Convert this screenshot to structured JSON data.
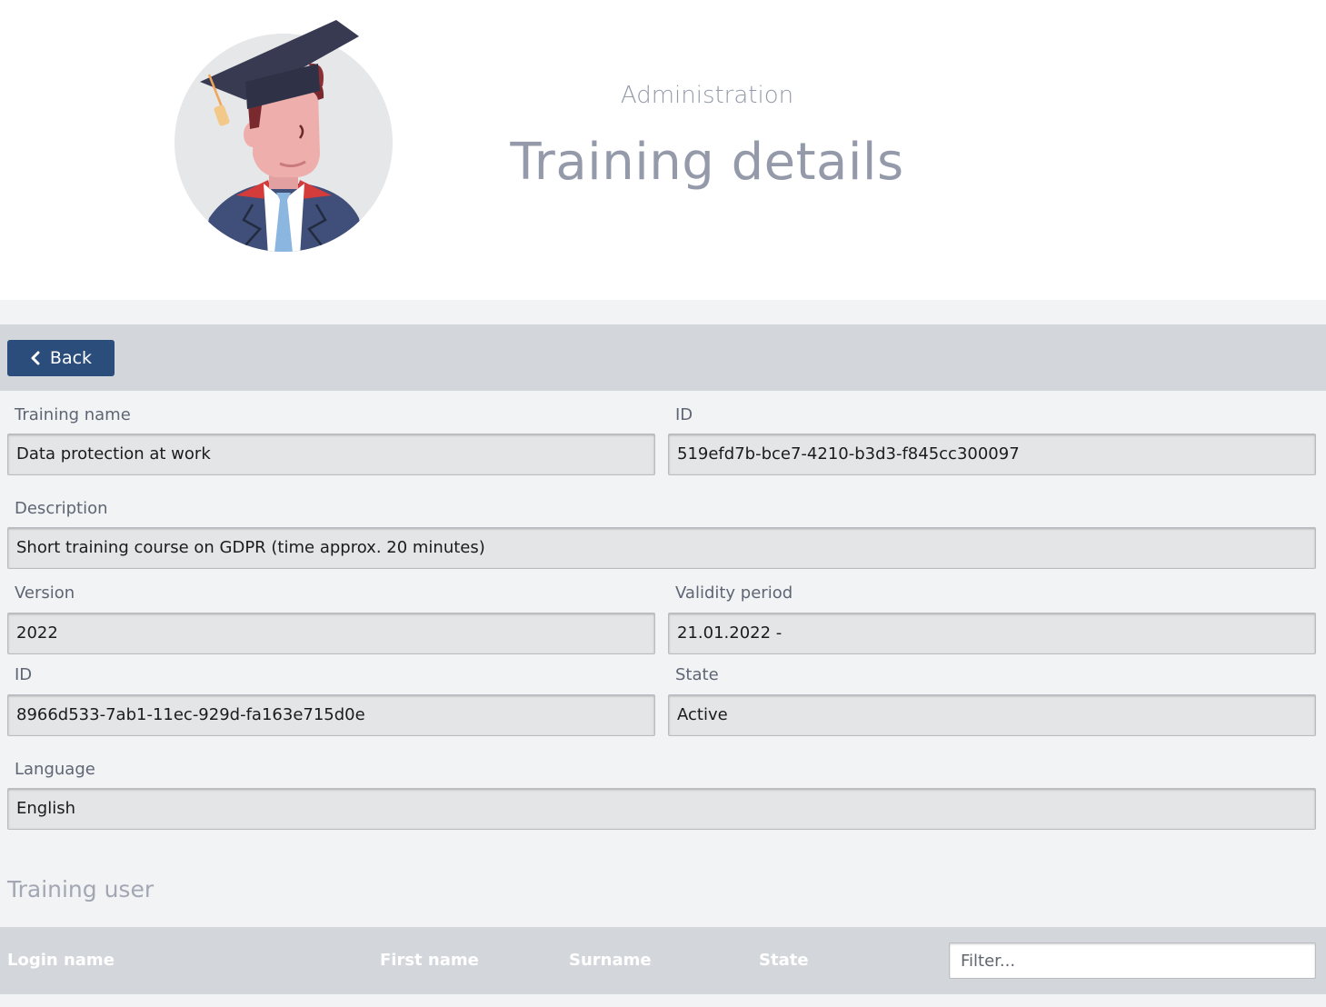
{
  "header": {
    "section": "Administration",
    "title": "Training details"
  },
  "toolbar": {
    "back_label": "Back",
    "back_icon": "chevron-left-icon"
  },
  "form": {
    "training_name": {
      "label": "Training name",
      "value": "Data protection at work"
    },
    "training_id": {
      "label": "ID",
      "value": "519efd7b-bce7-4210-b3d3-f845cc300097"
    },
    "description": {
      "label": "Description",
      "value": "Short training course on GDPR (time approx. 20 minutes)"
    },
    "version": {
      "label": "Version",
      "value": "2022"
    },
    "validity_period": {
      "label": "Validity period",
      "value": "21.01.2022 -"
    },
    "version_id": {
      "label": "ID",
      "value": "8966d533-7ab1-11ec-929d-fa163e715d0e"
    },
    "state": {
      "label": "State",
      "value": "Active"
    },
    "language": {
      "label": "Language",
      "value": "English"
    }
  },
  "training_user": {
    "title": "Training user",
    "columns": [
      "Login name",
      "First name",
      "Surname",
      "State"
    ],
    "filter_placeholder": "Filter..."
  },
  "colors": {
    "primary_button": "#2b4d7b",
    "toolbar_bg": "#d3d6db",
    "page_bg": "#f2f3f5",
    "title_text": "#949aa9"
  }
}
